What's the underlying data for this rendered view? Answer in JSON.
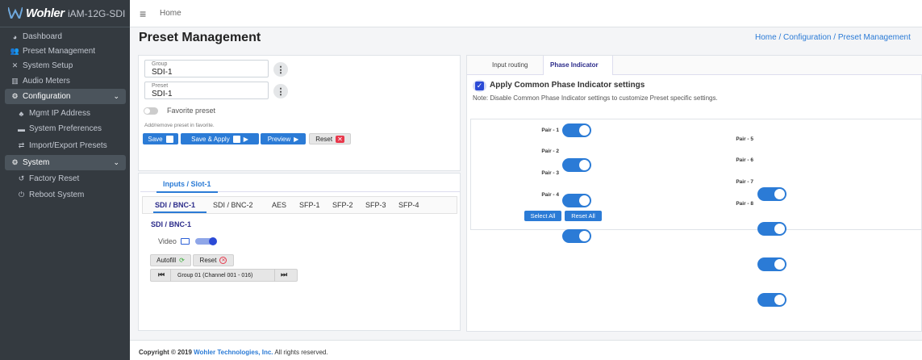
{
  "brand": {
    "name": "Wohler",
    "model": "iAM-12G-SDI"
  },
  "sidebar": {
    "items": [
      {
        "label": "Dashboard",
        "icon": "dashboard-icon"
      },
      {
        "label": "Preset Management",
        "icon": "users-icon"
      },
      {
        "label": "System Setup",
        "icon": "tools-icon"
      },
      {
        "label": "Audio Meters",
        "icon": "chart-icon"
      },
      {
        "label": "Configuration",
        "icon": "gear-icon"
      },
      {
        "label": "Mgmt IP Address",
        "icon": "network-icon"
      },
      {
        "label": "System Preferences",
        "icon": "keyboard-icon"
      },
      {
        "label": "Import/Export Presets",
        "icon": "exchange-icon"
      },
      {
        "label": "System",
        "icon": "gears-icon"
      },
      {
        "label": "Factory Reset",
        "icon": "undo-icon"
      },
      {
        "label": "Reboot System",
        "icon": "power-icon"
      }
    ]
  },
  "topbar": {
    "home": "Home"
  },
  "page": {
    "title": "Preset Management",
    "breadcrumb": "Home / Configuration / Preset Management"
  },
  "left": {
    "group_label": "Group",
    "group_value": "SDI-1",
    "preset_label": "Preset",
    "preset_value": "SDI-1",
    "favorite_label": "Favorite preset",
    "favorite_hint": "Add/remove preset in favorite.",
    "buttons": {
      "save": "Save",
      "save_apply": "Save & Apply",
      "preview": "Preview",
      "reset": "Reset"
    }
  },
  "inputs": {
    "header": "Inputs / Slot-1",
    "tabs": [
      "SDI / BNC-1",
      "SDI / BNC-2",
      "AES",
      "SFP-1",
      "SFP-2",
      "SFP-3",
      "SFP-4"
    ],
    "section": "SDI / BNC-1",
    "video_label": "Video",
    "autofill": "Autofill",
    "reset": "Reset",
    "group_nav": "Group 01 (Channel 001 - 016)"
  },
  "right": {
    "tabs": [
      "Input routing",
      "Phase Indicator"
    ],
    "apply_label": "Apply Common Phase Indicator settings",
    "note": "Note: Disable Common Phase Indicator settings to customize Preset specific settings.",
    "pairs_left": [
      "Pair - 1",
      "Pair - 2",
      "Pair - 3",
      "Pair - 4"
    ],
    "pairs_right": [
      "Pair - 5",
      "Pair - 6",
      "Pair - 7",
      "Pair - 8"
    ],
    "select_all": "Select All",
    "reset_all": "Reset All"
  },
  "footer": {
    "prefix": "Copyright © 2019 ",
    "company": "Wohler Technologies, Inc.",
    "suffix": " All rights reserved."
  }
}
